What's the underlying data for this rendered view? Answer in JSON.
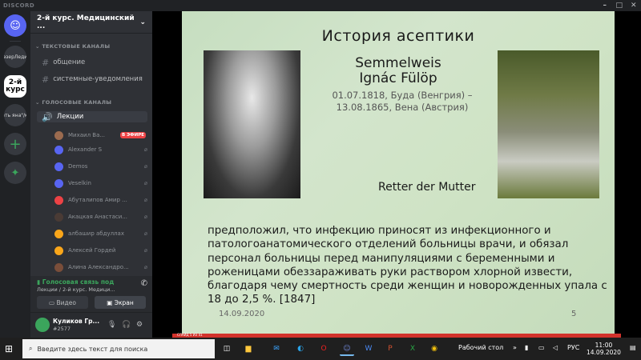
{
  "window": {
    "title": "DISCORD"
  },
  "rail": {
    "servers": [
      {
        "label": "",
        "icon": "discord-logo-icon"
      },
      {
        "label": "эзерЛеди"
      },
      {
        "label": "2-й курс"
      },
      {
        "label": "\"Тать яна\"/кур"
      },
      {
        "label": "+",
        "icon": "add-server-icon"
      },
      {
        "label": "",
        "icon": "explore-icon"
      }
    ]
  },
  "guild": {
    "name": "2-й курс. Медицинский ...",
    "text_category": "ТЕКСТОВЫЕ КАНАЛЫ",
    "text_channels": [
      "общение",
      "системные-уведомления"
    ],
    "voice_category": "ГОЛОСОВЫЕ КАНАЛЫ",
    "voice_channel": "Лекции",
    "users": [
      {
        "name": "Михаил Ва...",
        "badge": "В ЭФИРЕ",
        "color": "#9b6b4f"
      },
      {
        "name": "Alexander S",
        "color": "#5865f2"
      },
      {
        "name": "Demos",
        "color": "#5865f2"
      },
      {
        "name": "Veselkin",
        "color": "#5865f2"
      },
      {
        "name": "Абуталипов Амир ...",
        "color": "#ed4245"
      },
      {
        "name": "Акацкая Анастаси...",
        "color": "#4a3b35"
      },
      {
        "name": "албашир абдуллах",
        "color": "#faa61a"
      },
      {
        "name": "Алексей Гордей",
        "color": "#faa61a"
      },
      {
        "name": "Алина Александро...",
        "color": "#7a4e3a"
      }
    ]
  },
  "voice_panel": {
    "status": "Голосовая связь под",
    "location": "Лекции / 2-й курс. Медици...",
    "video_label": "Видео",
    "screen_label": "Экран"
  },
  "user_panel": {
    "name": "Куликов Гр...",
    "tag": "#2577"
  },
  "slide": {
    "title": "История асептики",
    "name_line1": "Semmelweis",
    "name_line2": "Ignác Fülöp",
    "date_line1": "01.07.1818, Буда (Венгрия) –",
    "date_line2": "13.08.1865, Вена (Австрия)",
    "retter": "Retter der Mutter",
    "body": "предположил, что инфекцию приносят из инфекционного и патологоанатомического отделений больницы врачи, и обязал персонал больницы перед манипуляциями с беременными и роженицами обеззараживать руки раствором хлорной извести, благодаря чему смертность среди женщин и новорожденных упала с 18 до 2,5 %. [1847]",
    "date": "14.09.2020",
    "number": "5",
    "bar_text": "СЛАЙД 5 ИЗ 41"
  },
  "taskbar": {
    "search_placeholder": "Введите здесь текст для поиска",
    "desktop_label": "Рабочий стол",
    "lang": "РУС",
    "time": "11:00",
    "date": "14.09.2020"
  }
}
